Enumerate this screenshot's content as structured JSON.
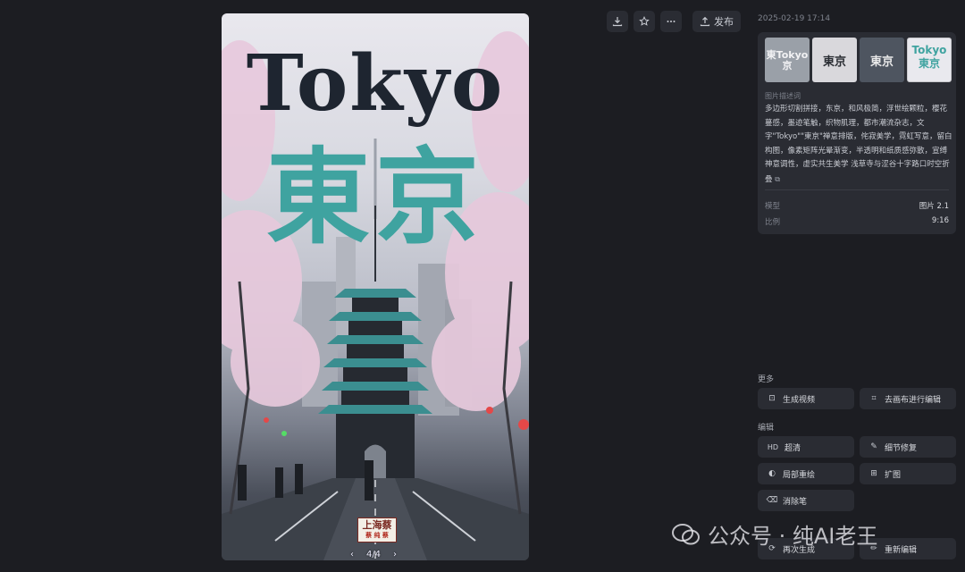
{
  "toolbar": {
    "download_icon": "download-icon",
    "favorite_icon": "star-icon",
    "more_icon": "more-icon",
    "publish_label": "发布"
  },
  "poster": {
    "latin_title": "Tokyo",
    "kanji_title": "東京",
    "stamp_main": "上海蔡",
    "stamp_sub": "蔡 纯 蔡",
    "pager": {
      "prev": "‹",
      "text": "4/4",
      "next": "›"
    }
  },
  "panel": {
    "timestamp": "2025-02-19 17:14",
    "thumbnails": [
      {
        "text": "東Tokyo 京",
        "bg": "#9aa0a8",
        "fg": "#f2f2f4"
      },
      {
        "text": "東京",
        "bg": "#d9d8dc",
        "fg": "#2a2d33"
      },
      {
        "text": "東京",
        "bg": "#4e5560",
        "fg": "#eaeaea"
      },
      {
        "text": "Tokyo 東京",
        "bg": "#e9e9ee",
        "fg": "#3fa3a0"
      }
    ],
    "description_label": "图片描述词",
    "description": "多边形切割拼接，东京，和风极简，浮世绘颗粒，樱花蔓感，墨迹笔触，织物肌理，都市潮流杂志，文字\"Tokyo\"\"東京\"禅意排版，侘寂美学，霓虹写意，留白构图，像素矩阵光晕渐变，半透明和纸质感弥散，宣缚神意调性，虚实共生美学 浅草寺与涩谷十字路口时空折叠",
    "copy_icon": "copy-icon",
    "model_label": "模型",
    "model_value": "图片 2.1",
    "ratio_label": "比例",
    "ratio_value": "9:16"
  },
  "more": {
    "label": "更多",
    "generate_video": "生成视频",
    "canvas_edit": "去画布进行编辑"
  },
  "edit": {
    "label": "编辑",
    "hd_icon_text": "HD",
    "hd": "超清",
    "detail_fix": "细节修复",
    "partial_redraw": "局部重绘",
    "expand": "扩图",
    "eraser": "消除笔",
    "regenerate": "再次生成",
    "reedit": "重新编辑"
  },
  "watermark": {
    "text": "公众号 · 纯AI老王"
  },
  "colors": {
    "background": "#1c1d22",
    "panel": "#2a2c33",
    "accent_teal": "#3fa3a0",
    "blossom": "#e7c9dc"
  }
}
